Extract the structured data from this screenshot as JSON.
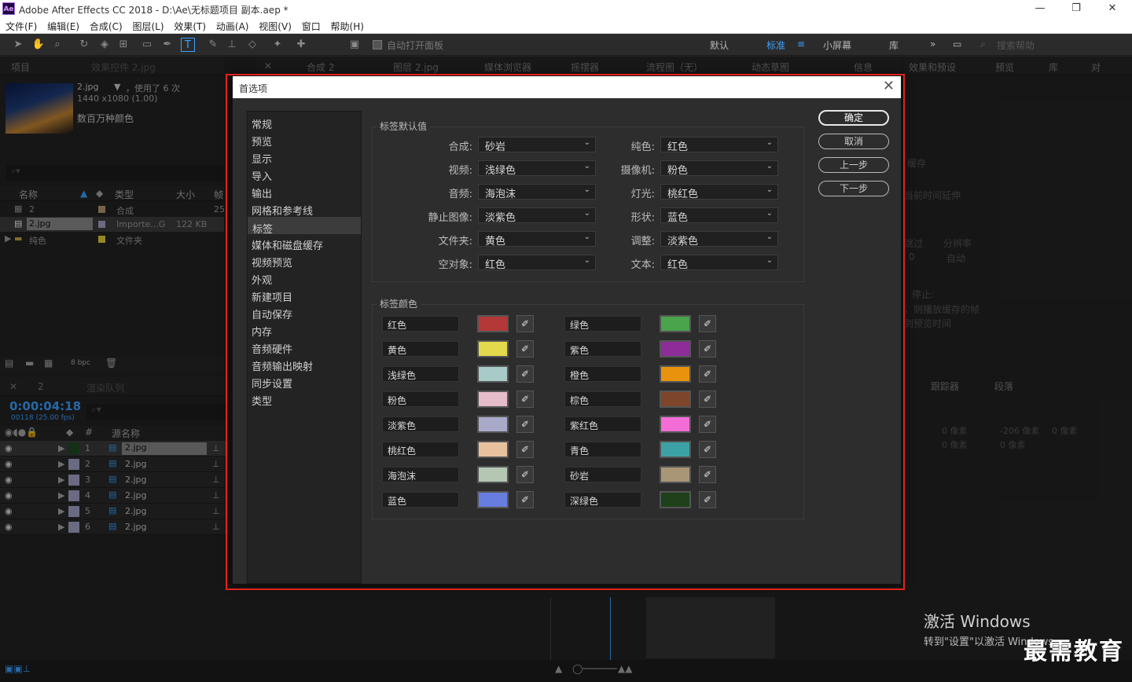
{
  "app": {
    "title": "Adobe After Effects CC 2018 - D:\\Ae\\无标题项目 副本.aep *",
    "logo": "Ae"
  },
  "menu": [
    "文件(F)",
    "编辑(E)",
    "合成(C)",
    "图层(L)",
    "效果(T)",
    "动画(A)",
    "视图(V)",
    "窗口",
    "帮助(H)"
  ],
  "toolbar": {
    "auto_open": "自动打开面板",
    "workspaces": [
      "默认",
      "标准",
      "小屏幕",
      "库"
    ],
    "search_placeholder": "搜索帮助"
  },
  "project_panel": {
    "tab": "项目",
    "effects_tab": "效果控件 2.jpg",
    "item_name": "2.jpg",
    "used": "，使用了 6 次",
    "dims": "1440 x1080 (1.00)",
    "colors": "数百万种颜色",
    "columns": [
      "名称",
      "类型",
      "大小",
      "帧"
    ],
    "rows": [
      {
        "name": "2",
        "type": "合成",
        "size": "",
        "frame": "25",
        "color": "#b49a74"
      },
      {
        "name": "2.jpg",
        "type": "Importe...G",
        "size": "122 KB",
        "frame": "",
        "color": "#a3a3c8"
      },
      {
        "name": "纯色",
        "type": "文件夹",
        "size": "",
        "frame": "",
        "color": "#e6d234"
      }
    ],
    "bpc": "8 bpc"
  },
  "center_tabs": [
    "合成 2",
    "图层 2.jpg",
    "媒体浏览器",
    "摇摆器",
    "流程图（无）",
    "动态草图"
  ],
  "right_tabs": [
    "信息",
    "效果和预设",
    "预览",
    "库",
    "对"
  ],
  "right_texts": [
    "缓存",
    "当前时间延伸",
    "跳过",
    "分辨率",
    "0",
    "自动",
    "停止:",
    "，则播放缓存的帧",
    "到预览时间"
  ],
  "tracker_tabs": [
    "跟踪器",
    "段落"
  ],
  "paragraph": [
    "0 像素",
    "-206 像素",
    "0 像素",
    "0 像素",
    "0 像素"
  ],
  "timeline": {
    "tab": "2",
    "render_tab": "渲染队列",
    "timecode": "0:00:04:18",
    "frames": "00118 (25.00 fps)",
    "col_source": "源名称",
    "rows": [
      {
        "num": "1",
        "name": "2.jpg",
        "color": "#1e4a22"
      },
      {
        "num": "2",
        "name": "2.jpg",
        "color": "#a3a3c8"
      },
      {
        "num": "3",
        "name": "2.jpg",
        "color": "#a3a3c8"
      },
      {
        "num": "4",
        "name": "2.jpg",
        "color": "#a3a3c8"
      },
      {
        "num": "5",
        "name": "2.jpg",
        "color": "#a3a3c8"
      },
      {
        "num": "6",
        "name": "2.jpg",
        "color": "#a3a3c8"
      }
    ]
  },
  "dialog": {
    "title": "首选项",
    "nav": [
      "常规",
      "预览",
      "显示",
      "导入",
      "输出",
      "网格和参考线",
      "标签",
      "媒体和磁盘缓存",
      "视频预览",
      "外观",
      "新建项目",
      "自动保存",
      "内存",
      "音频硬件",
      "音频输出映射",
      "同步设置",
      "类型"
    ],
    "selected_nav": "标签",
    "defaults_group": "标签默认值",
    "defaults_left": [
      {
        "label": "合成:",
        "value": "砂岩"
      },
      {
        "label": "视频:",
        "value": "浅绿色"
      },
      {
        "label": "音频:",
        "value": "海泡沫"
      },
      {
        "label": "静止图像:",
        "value": "淡紫色"
      },
      {
        "label": "文件夹:",
        "value": "黄色"
      },
      {
        "label": "空对象:",
        "value": "红色"
      }
    ],
    "defaults_right": [
      {
        "label": "纯色:",
        "value": "红色"
      },
      {
        "label": "摄像机:",
        "value": "粉色"
      },
      {
        "label": "灯光:",
        "value": "桃红色"
      },
      {
        "label": "形状:",
        "value": "蓝色"
      },
      {
        "label": "调整:",
        "value": "淡紫色"
      },
      {
        "label": "文本:",
        "value": "红色"
      }
    ],
    "colors_group": "标签颜色",
    "colors_left": [
      {
        "name": "红色",
        "hex": "#b53838"
      },
      {
        "name": "黄色",
        "hex": "#e4d84c"
      },
      {
        "name": "浅绿色",
        "hex": "#a9cbc7"
      },
      {
        "name": "粉色",
        "hex": "#e5bcc9"
      },
      {
        "name": "淡紫色",
        "hex": "#a9a9ca"
      },
      {
        "name": "桃红色",
        "hex": "#e7c19e"
      },
      {
        "name": "海泡沫",
        "hex": "#b3c7b3"
      },
      {
        "name": "蓝色",
        "hex": "#677de0"
      }
    ],
    "colors_right": [
      {
        "name": "绿色",
        "hex": "#4aa44c"
      },
      {
        "name": "紫色",
        "hex": "#8e2c9a"
      },
      {
        "name": "橙色",
        "hex": "#e8920d"
      },
      {
        "name": "棕色",
        "hex": "#7f452a"
      },
      {
        "name": "紫红色",
        "hex": "#f46dd6"
      },
      {
        "name": "青色",
        "hex": "#3da2a5"
      },
      {
        "name": "砂岩",
        "hex": "#a89677"
      },
      {
        "name": "深绿色",
        "hex": "#1e401b"
      }
    ],
    "buttons": {
      "ok": "确定",
      "cancel": "取消",
      "prev": "上一步",
      "next": "下一步"
    }
  },
  "activate": {
    "line1": "激活 Windows",
    "line2": "转到\"设置\"以激活 Windows。"
  },
  "watermark": "最需教育"
}
